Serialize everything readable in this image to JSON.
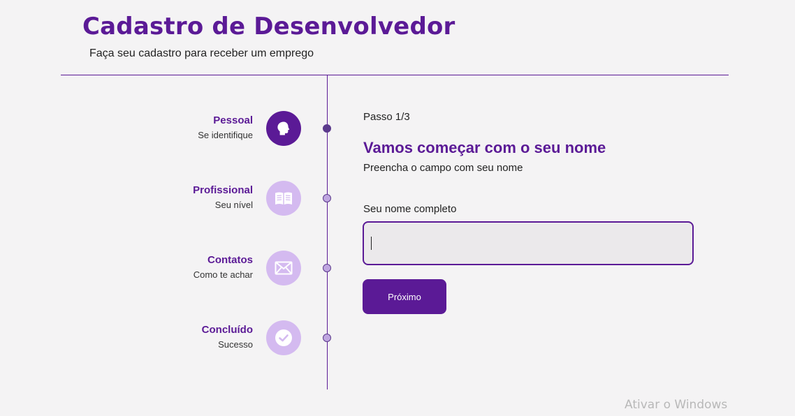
{
  "header": {
    "title": "Cadastro de Desenvolvedor",
    "subtitle": "Faça seu cadastro para receber um emprego"
  },
  "steps": [
    {
      "title": "Pessoal",
      "subtitle": "Se identifique",
      "icon": "person-head-icon",
      "active": true
    },
    {
      "title": "Profissional",
      "subtitle": "Seu nível",
      "icon": "book-icon",
      "active": false
    },
    {
      "title": "Contatos",
      "subtitle": "Como te achar",
      "icon": "envelope-icon",
      "active": false
    },
    {
      "title": "Concluído",
      "subtitle": "Sucesso",
      "icon": "check-circle-icon",
      "active": false
    }
  ],
  "form": {
    "step_counter": "Passo 1/3",
    "title": "Vamos começar com o seu nome",
    "subtitle": "Preencha o campo com seu nome",
    "name_label": "Seu nome completo",
    "name_value": "",
    "next_label": "Próximo"
  },
  "watermark": "Ativar o Windows",
  "colors": {
    "brand": "#5b1a96",
    "step_inactive": "#d4baf0",
    "background": "#f4f3f4"
  }
}
